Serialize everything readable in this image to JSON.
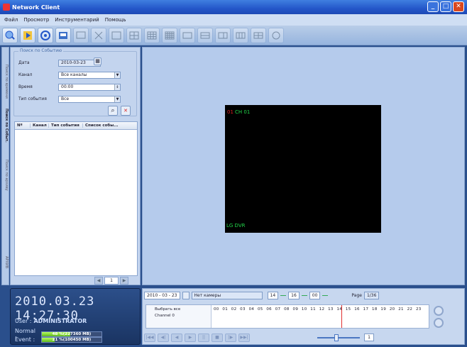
{
  "window": {
    "title": "Network Client",
    "buttons": [
      "_",
      "□",
      "✕"
    ]
  },
  "menu": [
    "Файл",
    "Просмотр",
    "Инструментарий",
    "Помощь"
  ],
  "toolbar": {
    "icons": [
      "search-icon",
      "playback-icon",
      "settings-icon",
      "save-icon",
      "monitor-icon",
      "layout-1-icon",
      "layout-4-icon",
      "layout-9-icon",
      "layout-16-icon",
      "layout-wide-icon",
      "layout-a-icon",
      "layout-b-icon",
      "layout-c-icon",
      "layout-d-icon",
      "fullscreen-icon"
    ]
  },
  "rail": {
    "tabs": [
      "Поиск по времени",
      "Поиск по Событ.",
      "Поиск по архиву",
      "АРХИВ"
    ]
  },
  "search": {
    "group_title": "Поиск по Событию",
    "date_label": "Дата",
    "date_value": "2010-03-23",
    "channel_label": "Канал",
    "channel_value": "Все каналы",
    "time_label": "Время",
    "time_value": "00:00",
    "event_type_label": "Тип события",
    "event_type_value": "Все"
  },
  "results": {
    "columns": [
      "Nº",
      "Канал",
      "Тип события",
      "Список собы..."
    ],
    "page": "1"
  },
  "video": {
    "channel_number": "01",
    "channel_name": "CH 01",
    "watermark": "LG DVR"
  },
  "status": {
    "clock": "2010.03.23 14:27:30",
    "user_label": "User :",
    "user_value": "ADMINISTRATOR",
    "normal_label": "Normal :",
    "normal_text": "48 %(227360 MB)",
    "normal_pct": 48,
    "event_label": "Event :",
    "event_text": "21 %(100450 MB)",
    "event_pct": 21
  },
  "timeline": {
    "date": "2010 - 03 - 23",
    "camera": "Нет камеры",
    "hour": "14",
    "minute": "16",
    "second": "00",
    "page_label": "Page",
    "page_value": "1/36",
    "select_all": "Выбрать все",
    "channel_row": "Channel 0",
    "hours": [
      "00",
      "01",
      "02",
      "03",
      "04",
      "05",
      "06",
      "07",
      "08",
      "09",
      "10",
      "11",
      "12",
      "13",
      "14",
      "15",
      "16",
      "17",
      "18",
      "19",
      "20",
      "21",
      "22",
      "23"
    ],
    "speed_value": "1",
    "playback": [
      "|◀◀",
      "◀|",
      "◀",
      "▶",
      "||",
      "■",
      "|▶",
      "▶▶|"
    ]
  },
  "colors": {
    "accent": "#2457c9",
    "panel": "#c3d4ee",
    "channel_red": "#e02020",
    "channel_green": "#22d64a"
  }
}
